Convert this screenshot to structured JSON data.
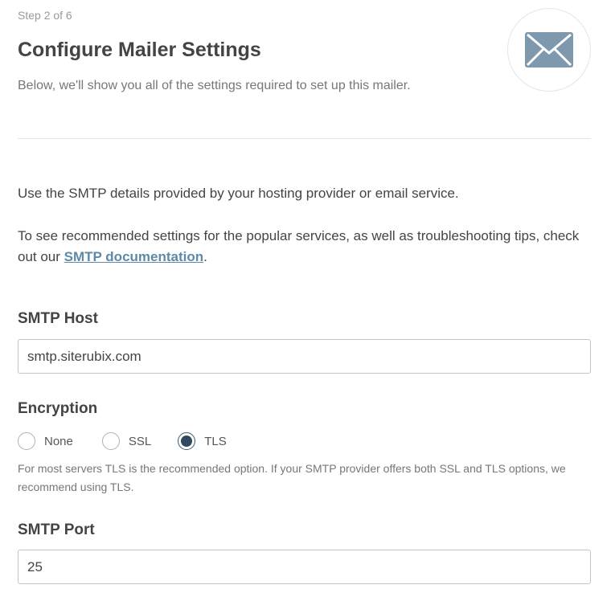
{
  "header": {
    "step": "Step 2 of 6",
    "title": "Configure Mailer Settings",
    "subtitle": "Below, we'll show you all of the settings required to set up this mailer."
  },
  "intro": {
    "line1": "Use the SMTP details provided by your hosting provider or email service.",
    "line2_prefix": "To see recommended settings for the popular services, as well as troubleshooting tips, check out our ",
    "line2_link": "SMTP documentation",
    "line2_suffix": "."
  },
  "smtp_host": {
    "label": "SMTP Host",
    "value": "smtp.siterubix.com"
  },
  "encryption": {
    "label": "Encryption",
    "options": [
      "None",
      "SSL",
      "TLS"
    ],
    "selected": "TLS",
    "hint": "For most servers TLS is the recommended option. If your SMTP provider offers both SSL and TLS options, we recommend using TLS."
  },
  "smtp_port": {
    "label": "SMTP Port",
    "value": "25"
  },
  "icons": {
    "mail": "envelope-icon"
  },
  "colors": {
    "link": "#5d8aa8",
    "radio_selected": "#2f4a5e",
    "envelope": "#7e98ad"
  }
}
